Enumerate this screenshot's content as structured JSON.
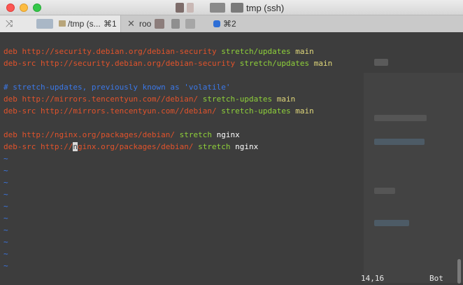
{
  "window": {
    "title": "tmp (ssh)",
    "traffic_lights": {
      "close": "#fc5753",
      "minimize": "#fdbc40",
      "maximize": "#34c84a"
    }
  },
  "tabs": [
    {
      "label": "/tmp (s...",
      "shortcut": "⌘1",
      "icon": "terminal-split-icon",
      "active": true
    },
    {
      "label": "roo",
      "shortcut": "⌘2",
      "icon": "close-icon",
      "active": false
    }
  ],
  "terminal": {
    "lines": [
      {
        "kw": "deb",
        "url": "http://security.debian.org/debian-security",
        "dist": "stretch/updates",
        "comp": "main"
      },
      {
        "kw": "deb-src",
        "url": "http://security.debian.org/debian-security",
        "dist": "stretch/updates",
        "comp": "main"
      },
      {
        "comment": "# stretch-updates, previously known as 'volatile'"
      },
      {
        "kw": "deb",
        "url": "http://mirrors.tencentyun.com//debian/",
        "dist": "stretch-updates",
        "comp": "main"
      },
      {
        "kw": "deb-src",
        "url": "http://mirrors.tencentyun.com//debian/",
        "dist": "stretch-updates",
        "comp": "main"
      },
      {
        "kw": "deb",
        "url": "http://nginx.org/packages/debian/",
        "dist": "stretch",
        "comp": "nginx"
      },
      {
        "kw": "deb-src",
        "url_before_cursor": "http://",
        "cursor_char": "n",
        "url_after_cursor": "ginx.org/packages/debian/",
        "dist": "stretch",
        "comp": "nginx"
      }
    ],
    "tilde": "~",
    "status_position": "14,16",
    "status_scroll": "Bot"
  },
  "colors": {
    "keyword": "#e2532b",
    "distribution": "#8fd13a",
    "component": "#e0d77a",
    "comment": "#3b78e8"
  }
}
